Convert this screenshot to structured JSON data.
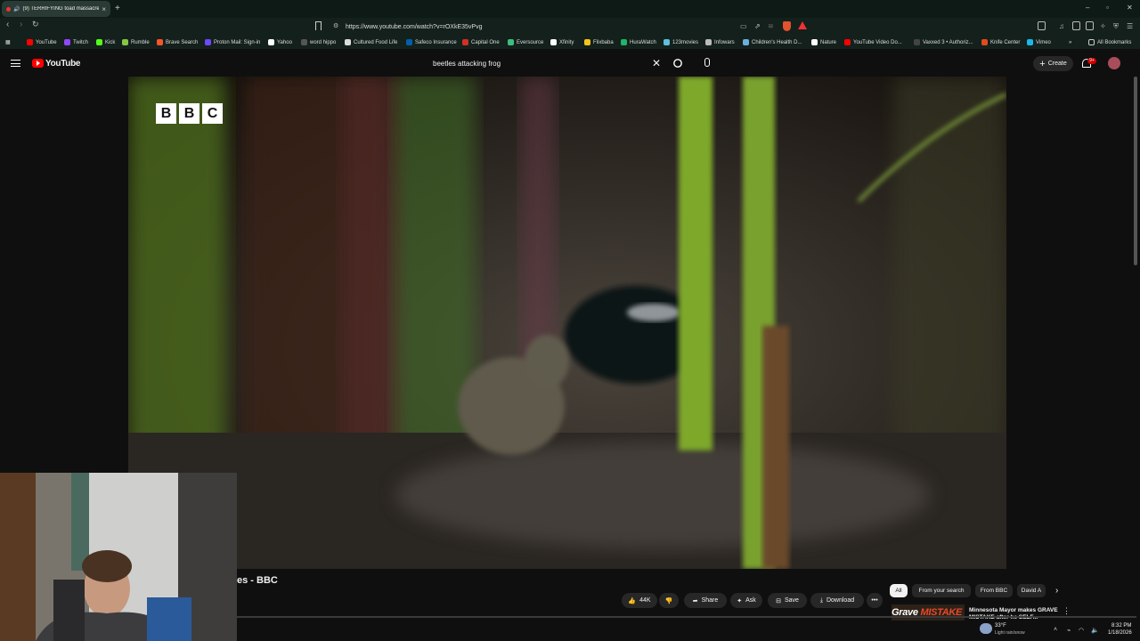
{
  "browser": {
    "tab": {
      "title": "(9) TERRIFYING toad massacre by beetles - BBC",
      "close_icon": "close-icon"
    },
    "new_tab_icon": "+",
    "window_controls": [
      "–",
      "▫",
      "✕"
    ],
    "url": "https://www.youtube.com/watch?v=rOXkE35vPvg",
    "bookmarks": [
      {
        "label": "YouTube",
        "color": "#ff0000"
      },
      {
        "label": "Twitch",
        "color": "#9146ff"
      },
      {
        "label": "Kick",
        "color": "#53fc18"
      },
      {
        "label": "Rumble",
        "color": "#85c742"
      },
      {
        "label": "Brave Search",
        "color": "#fb542b"
      },
      {
        "label": "Proton Mail: Sign-in",
        "color": "#6d4aff"
      },
      {
        "label": "Yahoo",
        "color": "#ffffff"
      },
      {
        "label": "word hippo",
        "color": "#555555"
      },
      {
        "label": "Cultured Food Life",
        "color": "#dddddd"
      },
      {
        "label": "Safeco Insurance",
        "color": "#0060a9"
      },
      {
        "label": "Capital One",
        "color": "#d03027"
      },
      {
        "label": "Eversource",
        "color": "#3bbf7c"
      },
      {
        "label": "Xfinity",
        "color": "#ffffff"
      },
      {
        "label": "Flixbaba",
        "color": "#f5c518"
      },
      {
        "label": "HuraWatch",
        "color": "#1fb36b"
      },
      {
        "label": "123movies",
        "color": "#5bc0de"
      },
      {
        "label": "Infowars",
        "color": "#bbbbbb"
      },
      {
        "label": "Children's Health D...",
        "color": "#6ab0de"
      },
      {
        "label": "Nature",
        "color": "#ffffff"
      },
      {
        "label": "YouTube Video Do...",
        "color": "#ff0000"
      },
      {
        "label": "Vaxxed 3 • Authoriz...",
        "color": "#444444"
      },
      {
        "label": "Knife Center",
        "color": "#e04a1c"
      },
      {
        "label": "Vimeo",
        "color": "#1ab7ea"
      }
    ],
    "bookmarks_more": "»",
    "all_bookmarks": "All Bookmarks"
  },
  "youtube": {
    "logo_text": "YouTube",
    "search_query": "beetles attacking frog",
    "create_label": "Create",
    "notification_count": "9+",
    "video": {
      "channel_watermark": [
        "B",
        "B",
        "C"
      ]
    },
    "title_partial": "es - BBC",
    "actions": {
      "like_count": "44K",
      "share": "Share",
      "ask": "Ask",
      "save": "Save",
      "download": "Download",
      "more": "•••"
    },
    "chips": [
      "All",
      "From your search",
      "From BBC",
      "David A"
    ],
    "recommendation": {
      "thumb_text_white": "Grave",
      "thumb_text_red": "MISTAKE",
      "title": "Minnesota Mayor makes GRAVE MISTAKE after he SELF..."
    }
  },
  "taskbar": {
    "weather_temp": "33°F",
    "weather_desc": "Light rain/snow",
    "time": "8:32 PM",
    "date": "1/18/2026"
  }
}
